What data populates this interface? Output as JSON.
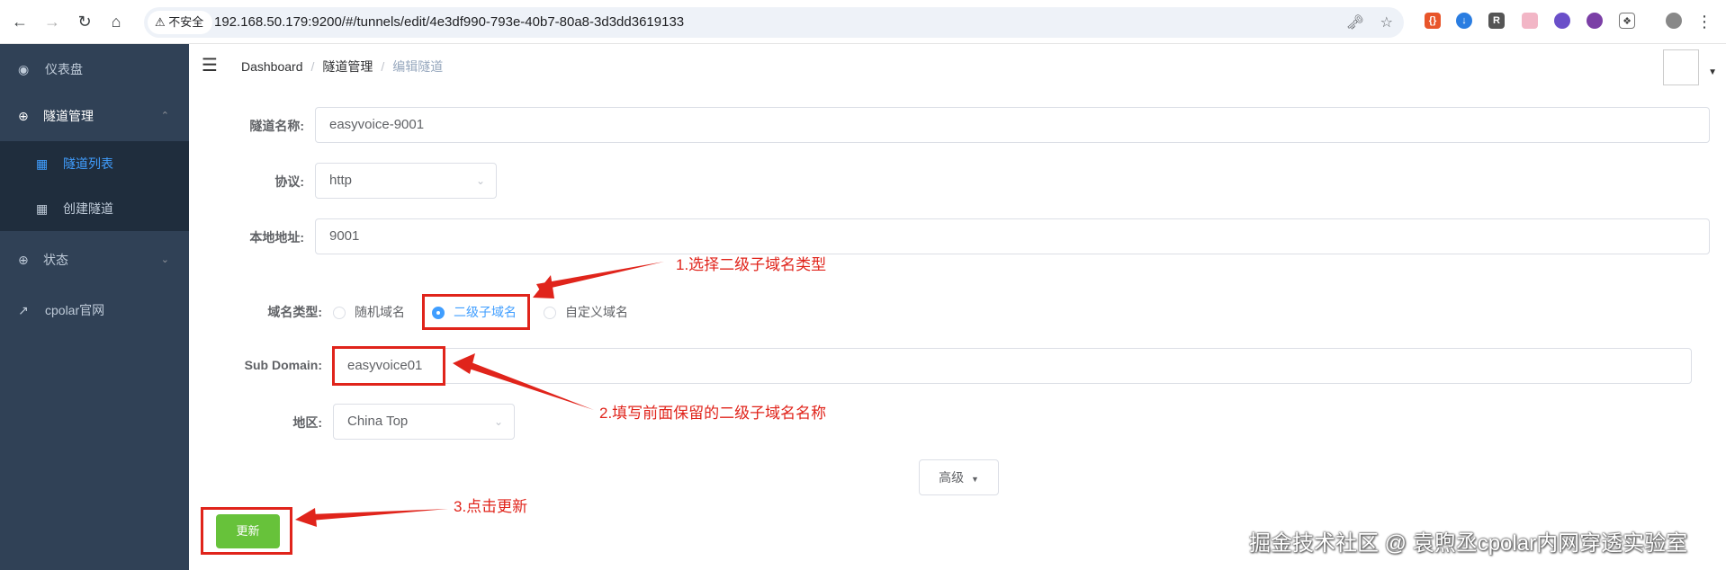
{
  "browser": {
    "security_label": "不安全",
    "url": "192.168.50.179:9200/#/tunnels/edit/4e3df990-793e-40b7-80a8-3d3dd3619133"
  },
  "sidebar": {
    "items": [
      {
        "label": "仪表盘",
        "icon": "dashboard-icon"
      },
      {
        "label": "隧道管理",
        "icon": "plus-circle-icon"
      },
      {
        "label": "状态",
        "icon": "plus-circle-icon"
      },
      {
        "label": "cpolar官网",
        "icon": "external-link-icon"
      }
    ],
    "sub_items": [
      {
        "label": "隧道列表",
        "icon": "grid-icon",
        "active": true
      },
      {
        "label": "创建隧道",
        "icon": "grid-icon",
        "active": false
      }
    ]
  },
  "breadcrumb": {
    "items": [
      "Dashboard",
      "隧道管理"
    ],
    "current": "编辑隧道"
  },
  "form": {
    "name_label": "隧道名称:",
    "name_value": "easyvoice-9001",
    "protocol_label": "协议:",
    "protocol_value": "http",
    "local_label": "本地地址:",
    "local_value": "9001",
    "domain_type_label": "域名类型:",
    "domain_types": [
      "随机域名",
      "二级子域名",
      "自定义域名"
    ],
    "domain_type_selected": "二级子域名",
    "subdomain_label": "Sub Domain:",
    "subdomain_value": "easyvoice01",
    "region_label": "地区:",
    "region_value": "China Top",
    "advanced_label": "高级",
    "update_label": "更新"
  },
  "annotations": {
    "step1": "1.选择二级子域名类型",
    "step2": "2.填写前面保留的二级子域名名称",
    "step3": "3.点击更新",
    "color": "#e0241b"
  },
  "watermark": "掘金技术社区 @ 袁煦丞cpolar内网穿透实验室",
  "colors": {
    "sidebar_bg": "#304156",
    "submenu_bg": "#1f2d3d",
    "accent": "#409eff",
    "success": "#67c23a"
  }
}
